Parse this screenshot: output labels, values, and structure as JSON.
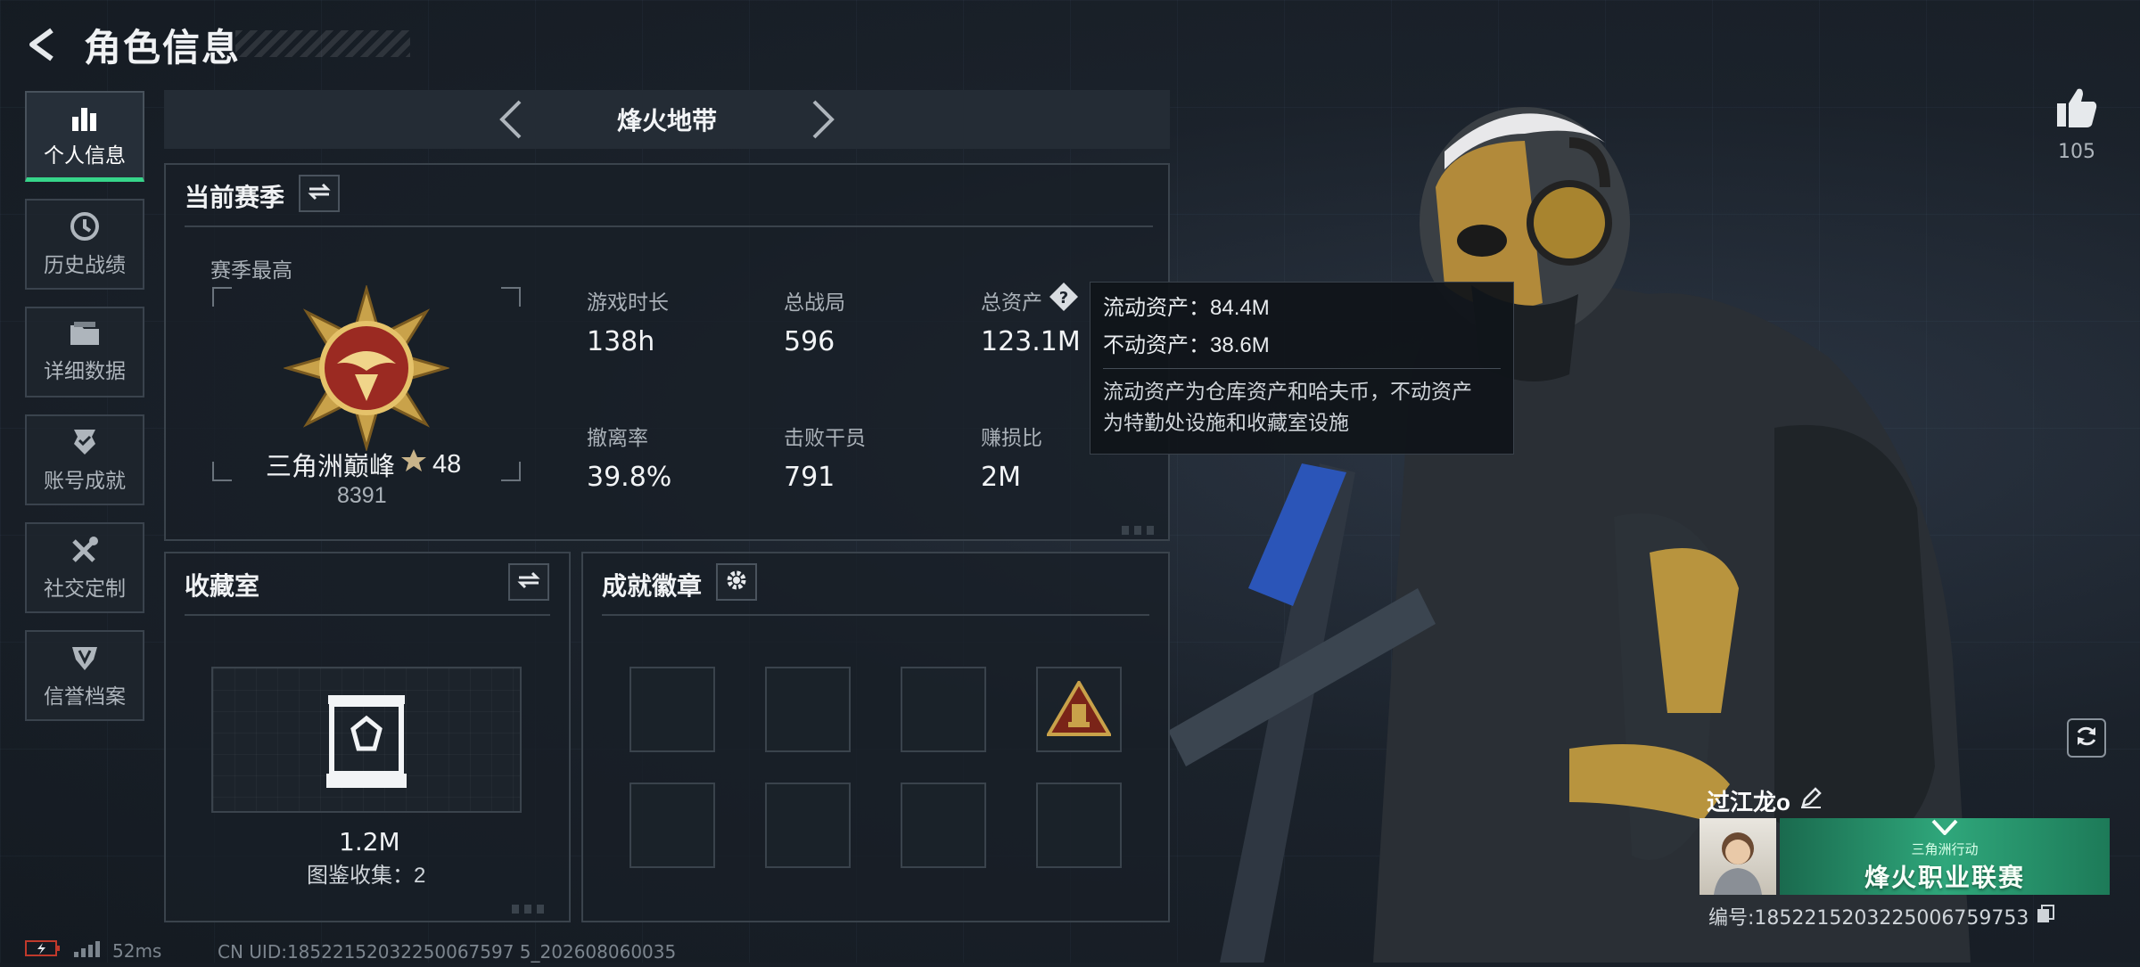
{
  "header": {
    "title": "角色信息"
  },
  "nav": [
    {
      "label": "个人信息",
      "icon": "bar-chart-icon",
      "active": true
    },
    {
      "label": "历史战绩",
      "icon": "history-icon"
    },
    {
      "label": "详细数据",
      "icon": "folder-icon"
    },
    {
      "label": "账号成就",
      "icon": "achievement-icon"
    },
    {
      "label": "社交定制",
      "icon": "tools-icon"
    },
    {
      "label": "信誉档案",
      "icon": "shield-icon"
    }
  ],
  "map": {
    "name": "烽火地带"
  },
  "season": {
    "title": "当前赛季",
    "best_label": "赛季最高",
    "rank_name": "三角洲巅峰",
    "rank_stars": "48",
    "rank_score": "8391",
    "stats": [
      {
        "label": "游戏时长",
        "value": "138h"
      },
      {
        "label": "总战局",
        "value": "596"
      },
      {
        "label": "总资产",
        "value": "123.1M"
      },
      {
        "label": "撤离率",
        "value": "39.8%"
      },
      {
        "label": "击败干员",
        "value": "791"
      },
      {
        "label": "赚损比",
        "value": "2M"
      }
    ]
  },
  "tooltip": {
    "liquid": "流动资产：84.4M",
    "fixed": "不动资产：38.6M",
    "desc1": "流动资产为仓库资产和哈夫币，不动资产",
    "desc2": "为特勤处设施和收藏室设施"
  },
  "collection": {
    "title": "收藏室",
    "value": "1.2M",
    "count": "图鉴收集：2"
  },
  "badges": {
    "title": "成就徽章"
  },
  "likes": {
    "count": "105"
  },
  "player": {
    "name": "过江龙o",
    "id": "编号:1852215203225006759753",
    "banner_sub": "三角洲行动",
    "banner_text": "烽火职业联赛"
  },
  "status": {
    "ping": "52ms",
    "uid": "CN UID:18522152032250067597 5_202608060035"
  },
  "colors": {
    "accent": "#36d58a",
    "panel_border": "#3a434c",
    "gold": "#c9a24a"
  }
}
